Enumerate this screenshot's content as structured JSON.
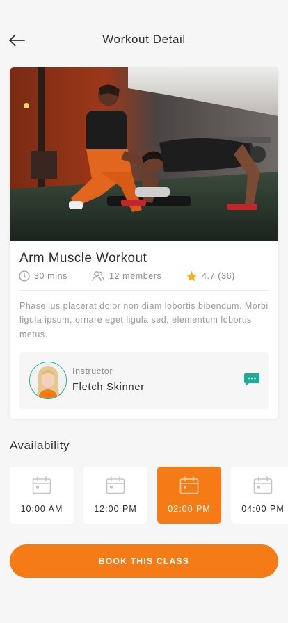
{
  "header": {
    "title": "Workout Detail",
    "back_icon": "arrow-left-icon"
  },
  "workout": {
    "title": "Arm Muscle Workout",
    "duration": "30 mins",
    "members": "12 members",
    "rating": "4.7 (36)",
    "description": "Phasellus placerat dolor non diam lobortis bibendum. Morbi ligula ipsum, ornare eget ligula sed, elementum lobortis metus."
  },
  "instructor": {
    "label": "Instructor",
    "name": "Fletch Skinner",
    "chat_icon": "chat-bubble-icon"
  },
  "availability": {
    "title": "Availability",
    "slots": [
      {
        "time": "10:00 AM",
        "selected": false
      },
      {
        "time": "12:00 PM",
        "selected": false
      },
      {
        "time": "02:00 PM",
        "selected": true
      },
      {
        "time": "04:00 PM",
        "selected": false
      }
    ]
  },
  "book_button": {
    "label": "BOOK THIS CLASS"
  },
  "colors": {
    "accent": "#f47b16",
    "teal": "#1aae95",
    "star": "#f1b21e",
    "text": "#2b2b2b",
    "muted": "#9a9a9a"
  }
}
